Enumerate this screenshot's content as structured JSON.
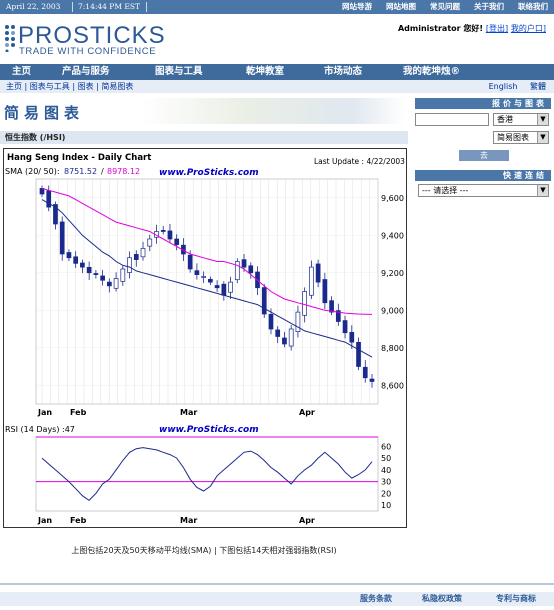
{
  "topbar": {
    "date": "April 22, 2003",
    "time": "7:14:44 PM EST",
    "links": [
      "网站导游",
      "网站地图",
      "常见问题",
      "关于我们",
      "联络我们"
    ]
  },
  "logo": {
    "name": "PROSTICKS",
    "tagline": "TRADE WITH CONFIDENCE"
  },
  "user": {
    "greeting": "Administrator 您好!",
    "logout": "[登出]",
    "account": "我的户口]"
  },
  "nav": [
    "主页",
    "产品与服务",
    "图表与工具",
    "乾坤教室",
    "市场动态",
    "我的乾坤烛®"
  ],
  "breadcrumb": [
    "主页",
    "图表与工具",
    "图表",
    "简易图表"
  ],
  "breadcrumb_sep": "|",
  "lang": {
    "english": "English",
    "trad": "繁體"
  },
  "page_title": "简易图表",
  "section_title": "恒生指数 (/HSI)",
  "right": {
    "quote_title": "报价与图表",
    "market_select": "香港",
    "chart_select": "简易图表",
    "go": "去",
    "quicklink_title": "快速连结",
    "quicklink_select": "--- 请选择 ---"
  },
  "chart": {
    "title": "Hang Seng Index - Daily Chart",
    "last_update": "Last Update : 4/22/2003",
    "watermark": "www.ProSticks.com",
    "sma_label": "SMA (20/ 50):",
    "sma20_value": "8751.52",
    "sma50_value": "8978.12",
    "sma_sep": "/",
    "rsi_label": "RSI (14 Days) :47",
    "colors": {
      "sma20": "#1a2a8c",
      "sma50": "#e000e0",
      "candle": "#1a2a8c",
      "rsi_line": "#1a2a8c",
      "rsi_bounds": "#e000e0"
    }
  },
  "caption": "上图包括20天及50天移动平均线(SMA) | 下图包括14天相对强弱指数(RSI)",
  "footer": [
    "服务条款",
    "私隐权政策",
    "专利与商标"
  ],
  "chart_data": [
    {
      "type": "candlestick",
      "title": "Hang Seng Index - Daily Chart",
      "x_ticks": [
        "Jan",
        "Feb",
        "Mar",
        "Apr"
      ],
      "y_ticks": [
        8600,
        8800,
        9000,
        9200,
        9400,
        9600
      ],
      "ylim": [
        8500,
        9700
      ],
      "grid": true,
      "series": [
        {
          "name": "SMA (20)",
          "values": [
            9590,
            9570,
            9550,
            9520,
            9480,
            9440,
            9400,
            9370,
            9340,
            9310,
            9290,
            9260,
            9240,
            9230,
            9210,
            9200,
            9190,
            9180,
            9170,
            9160,
            9150,
            9140,
            9130,
            9120,
            9110,
            9100,
            9090,
            9080,
            9070,
            9060,
            9050,
            9040,
            9030,
            9010,
            8990,
            8970,
            8950,
            8930,
            8910,
            8890,
            8880,
            8870,
            8860,
            8850,
            8840,
            8830,
            8810,
            8790,
            8770,
            8750
          ]
        },
        {
          "name": "SMA (50)",
          "values": [
            9650,
            9640,
            9630,
            9620,
            9610,
            9590,
            9570,
            9550,
            9530,
            9510,
            9490,
            9470,
            9460,
            9450,
            9440,
            9430,
            9420,
            9400,
            9380,
            9360,
            9340,
            9320,
            9300,
            9290,
            9280,
            9270,
            9260,
            9260,
            9250,
            9240,
            9220,
            9190,
            9160,
            9130,
            9100,
            9080,
            9060,
            9050,
            9040,
            9030,
            9020,
            9010,
            9000,
            8995,
            8990,
            8985,
            8982,
            8980,
            8979,
            8978
          ]
        },
        {
          "name": "Close",
          "values": [
            9620,
            9550,
            9460,
            9300,
            9280,
            9250,
            9230,
            9200,
            9190,
            9160,
            9130,
            9170,
            9220,
            9280,
            9270,
            9330,
            9380,
            9420,
            9420,
            9380,
            9350,
            9300,
            9220,
            9190,
            9180,
            9150,
            9120,
            9080,
            9150,
            9260,
            9230,
            9200,
            9120,
            8980,
            8900,
            8860,
            8820,
            8900,
            8990,
            9100,
            9230,
            9150,
            9040,
            8990,
            8940,
            8880,
            8830,
            8700,
            8640,
            8620
          ]
        }
      ]
    },
    {
      "type": "line",
      "title": "RSI (14 Days) :47",
      "x_ticks": [
        "Jan",
        "Feb",
        "Mar",
        "Apr"
      ],
      "y_ticks": [
        10,
        20,
        30,
        40,
        50,
        60
      ],
      "ylim": [
        5,
        68
      ],
      "reference_lines": [
        30,
        70
      ],
      "series": [
        {
          "name": "RSI",
          "values": [
            50,
            45,
            40,
            35,
            30,
            24,
            18,
            14,
            20,
            28,
            32,
            40,
            48,
            55,
            58,
            59,
            58,
            57,
            55,
            53,
            50,
            42,
            32,
            25,
            22,
            26,
            35,
            40,
            45,
            50,
            55,
            56,
            53,
            48,
            42,
            38,
            33,
            28,
            35,
            40,
            44,
            50,
            55,
            50,
            45,
            38,
            33,
            36,
            40,
            47
          ]
        }
      ]
    }
  ]
}
